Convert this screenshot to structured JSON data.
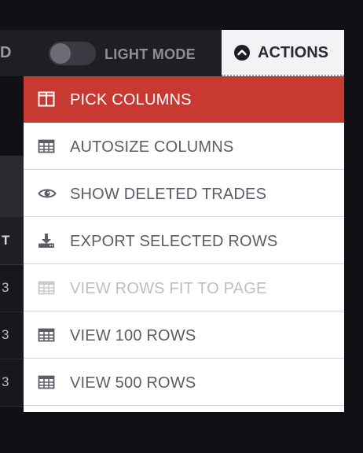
{
  "topbar": {
    "partial_label": "D",
    "theme_toggle": {
      "label": "LIGHT MODE",
      "on": false
    },
    "actions_button": {
      "label": "ACTIONS",
      "icon": "chevron-up-circle-icon"
    }
  },
  "background_table": {
    "column_header": "T",
    "row_values": [
      "3",
      "3",
      "3"
    ]
  },
  "menu": {
    "items": [
      {
        "label": "PICK COLUMNS",
        "icon": "columns-icon",
        "state": "active"
      },
      {
        "label": "AUTOSIZE COLUMNS",
        "icon": "table-icon",
        "state": "normal"
      },
      {
        "label": "SHOW DELETED TRADES",
        "icon": "eye-icon",
        "state": "normal"
      },
      {
        "label": "EXPORT SELECTED ROWS",
        "icon": "download-icon",
        "state": "normal"
      },
      {
        "label": "VIEW ROWS FIT TO PAGE",
        "icon": "table-icon",
        "state": "disabled"
      },
      {
        "label": "VIEW 100 ROWS",
        "icon": "table-icon",
        "state": "normal"
      },
      {
        "label": "VIEW 500 ROWS",
        "icon": "table-icon",
        "state": "normal"
      }
    ]
  },
  "colors": {
    "accent": "#c83a31",
    "menu_text": "#5a5c66",
    "disabled_text": "#bdbec4",
    "background": "#111115"
  }
}
